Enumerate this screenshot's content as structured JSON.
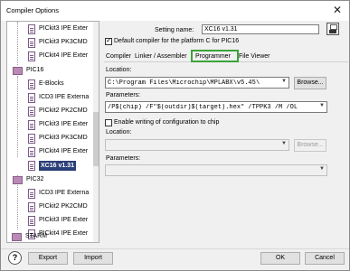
{
  "window": {
    "title": "Compiler Options",
    "close_glyph": "✕"
  },
  "tree": {
    "rows": [
      {
        "label": "PICkit3 IPE Exter"
      },
      {
        "label": "PICkit3 PK3CMD"
      },
      {
        "label": "PICkit4 IPE Exter"
      },
      {
        "label": "PIC16"
      },
      {
        "label": "E-Blocks"
      },
      {
        "label": "ICD3 IPE Externa"
      },
      {
        "label": "PICkit2 PK2CMD"
      },
      {
        "label": "PICkit3 IPE Exter"
      },
      {
        "label": "PICkit3 PK3CMD"
      },
      {
        "label": "PICkit4 IPE Exter"
      },
      {
        "label": "XC16 v1.31"
      },
      {
        "label": "PIC32"
      },
      {
        "label": "ICD3 IPE Externa"
      },
      {
        "label": "PICkit2 PK2CMD"
      },
      {
        "label": "PICkit3 IPE Exter"
      },
      {
        "label": "PICkit4 IPE Exter"
      },
      {
        "label": "STARM"
      }
    ]
  },
  "setting_name": {
    "label": "Setting name:",
    "value": "XC16 v1.31"
  },
  "default_compiler": {
    "label": "Default compiler for the platform C for PIC16",
    "checked": true
  },
  "tabs": [
    {
      "label": "Compiler"
    },
    {
      "label": "Linker / Assembler"
    },
    {
      "label": "Programmer"
    },
    {
      "label": "File Viewer"
    }
  ],
  "programmer": {
    "location_label": "Location:",
    "location_value": "C:\\Program Files\\Microchip\\MPLABX\\v5.45\\",
    "browse_label": "Browse...",
    "parameters_label": "Parameters:",
    "parameters_value": "/P$(chip) /F\"$(outdir)$(target).hex\" /TPPK3 /M /OL",
    "enable_config_label": "Enable writing of configuration to chip",
    "config_location_label": "Location:",
    "config_location_value": "",
    "config_browse_label": "Browse...",
    "config_parameters_label": "Parameters:",
    "config_parameters_value": ""
  },
  "footer": {
    "help_glyph": "?",
    "export_label": "Export",
    "import_label": "Import",
    "ok_label": "OK",
    "cancel_label": "Cancel"
  }
}
